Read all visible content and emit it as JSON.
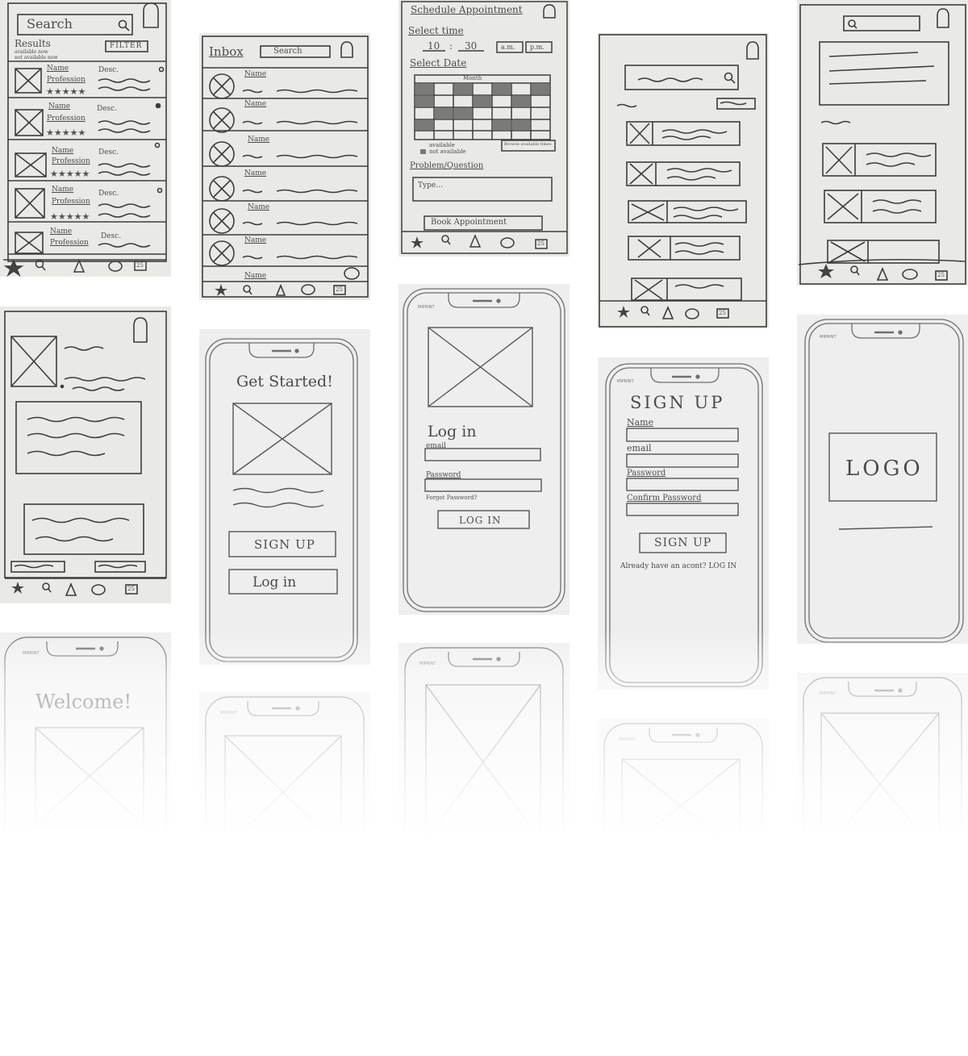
{
  "results_screen": {
    "search_label": "Search",
    "results_label": "Results",
    "filter_label": "FILTER",
    "legend_available": "available now",
    "legend_not_available": "not available now",
    "items": [
      {
        "name": "Name",
        "profession": "Profession",
        "desc": "Desc."
      },
      {
        "name": "Name",
        "profession": "Profession",
        "desc": "Desc."
      },
      {
        "name": "Name",
        "profession": "Profession",
        "desc": "Desc."
      },
      {
        "name": "Name",
        "profession": "Profession",
        "desc": "Desc."
      },
      {
        "name": "Name",
        "profession": "Profession",
        "desc": "Desc."
      }
    ]
  },
  "inbox_screen": {
    "title": "Inbox",
    "search_label": "Search",
    "items": [
      "Name",
      "Name",
      "Name",
      "Name",
      "Name",
      "Name",
      "Name"
    ]
  },
  "schedule_screen": {
    "title": "Schedule Appointment",
    "select_time_label": "Select time",
    "hour": "10",
    "minute": "30",
    "am_label": "a.m.",
    "pm_label": "p.m.",
    "select_date_label": "Select Date",
    "month_label": "Month",
    "legend_available": "available",
    "legend_not_available": "not available",
    "browse_button": "Browse available times",
    "problem_label": "Problem/Question",
    "type_placeholder": "Type...",
    "book_button": "Book Appointment",
    "calendar_day": "25"
  },
  "get_started_screen": {
    "title": "Get Started!",
    "sign_up_button": "SIGN UP",
    "log_in_button": "Log in"
  },
  "login_screen": {
    "brand": "MIPRINT",
    "title": "Log in",
    "email_label": "email",
    "password_label": "Password",
    "forgot_label": "Forgot Password?",
    "login_button": "LOG IN"
  },
  "signup_screen": {
    "brand": "MIPRINT",
    "title": "SIGN UP",
    "name_label": "Name",
    "email_label": "email",
    "password_label": "Password",
    "confirm_label": "Confirm Password",
    "signup_button": "SIGN UP",
    "already_label": "Already have an acont? LOG IN"
  },
  "logo_screen": {
    "brand": "MIPRINT",
    "logo_label": "LOGO"
  },
  "welcome_screen": {
    "brand": "MIPRINT",
    "title": "Welcome!"
  },
  "faded_screens": {
    "brand_a": "MIPRINT",
    "brand_b": "MIPRINT",
    "brand_c": "MIPRINT",
    "brand_d": "MIPRINT"
  },
  "nav": {
    "calendar_day": "25"
  },
  "colors": {
    "paper": "#e9e9e6",
    "pencil": "#3a3a3a",
    "background": "#ffffff"
  }
}
